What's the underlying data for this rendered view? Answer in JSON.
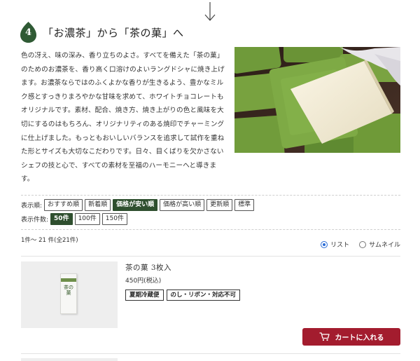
{
  "step": {
    "number": "4",
    "title": "「お濃茶」から「茶の菓」へ"
  },
  "description": "色の冴え、味の深み、香り立ちのよさ。すべてを備えた「茶の菓」のためのお濃茶を、香り高く口溶けのよいラングドシャに焼き上げます。お濃茶ならではのふくよかな香りが生きるよう、豊かなミルク感とすっきりまろやかな甘味を求めて、ホワイトチョコレートもオリジナルです。素材、配合、焼き方、焼き上がりの色と風味を大切にするのはもちろん、オリジナリティのある焼印でチャーミングに仕上げました。もっともおいしいバランスを追求して試作を重ねた形とサイズも大切なこだわりです。日々、目くばりを欠かさないシェフの技と心で、すべての素材を至福のハーモニーへと導きます。",
  "sort": {
    "label": "表示順:",
    "options": [
      "おすすめ順",
      "新着順",
      "価格が安い順",
      "価格が高い順",
      "更新順",
      "標準"
    ],
    "active_index": 2
  },
  "per_page": {
    "label": "表示件数:",
    "options": [
      "50件",
      "100件",
      "150件"
    ],
    "active_index": 0
  },
  "result_count": "1件～ 21 件(全21件)",
  "view": {
    "list_label": "リスト",
    "thumb_label": "サムネイル",
    "selected": "list"
  },
  "product": {
    "name": "茶の菓 3枚入",
    "price": "450円(税込)",
    "tags": [
      "夏期冷蔵便",
      "のし・リボン・対応不可"
    ],
    "package_text": "茶の菓",
    "cart_label": "カートに入れる"
  },
  "colors": {
    "accent_green": "#2f4f2f",
    "cart_red": "#a31c2e",
    "radio_blue": "#2a6cd6"
  },
  "icons": [
    "down-arrow-icon",
    "leaf-badge-icon",
    "cart-icon"
  ]
}
